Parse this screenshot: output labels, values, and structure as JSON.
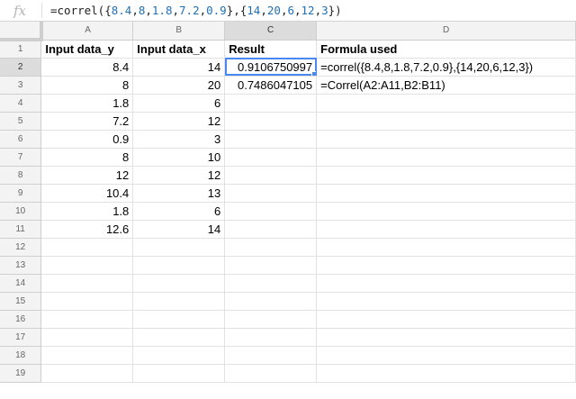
{
  "formula_bar": {
    "icon": "fx",
    "text_parts": [
      {
        "t": "=correl({",
        "n": false
      },
      {
        "t": "8.4",
        "n": true
      },
      {
        "t": ",",
        "n": false
      },
      {
        "t": "8",
        "n": true
      },
      {
        "t": ",",
        "n": false
      },
      {
        "t": "1.8",
        "n": true
      },
      {
        "t": ",",
        "n": false
      },
      {
        "t": "7.2",
        "n": true
      },
      {
        "t": ",",
        "n": false
      },
      {
        "t": "0.9",
        "n": true
      },
      {
        "t": "},{",
        "n": false
      },
      {
        "t": "14",
        "n": true
      },
      {
        "t": ",",
        "n": false
      },
      {
        "t": "20",
        "n": true
      },
      {
        "t": ",",
        "n": false
      },
      {
        "t": "6",
        "n": true
      },
      {
        "t": ",",
        "n": false
      },
      {
        "t": "12",
        "n": true
      },
      {
        "t": ",",
        "n": false
      },
      {
        "t": "3",
        "n": true
      },
      {
        "t": "})",
        "n": false
      }
    ]
  },
  "columns": [
    "A",
    "B",
    "C",
    "D"
  ],
  "selected": {
    "row": 2,
    "col": "C"
  },
  "rows": [
    {
      "n": "1",
      "cells": [
        "Input data_y",
        "Input data_x",
        "Result",
        "Formula used"
      ]
    },
    {
      "n": "2",
      "cells": [
        "8.4",
        "14",
        "0.9106750997",
        "=correl({8.4,8,1.8,7.2,0.9},{14,20,6,12,3})"
      ]
    },
    {
      "n": "3",
      "cells": [
        "8",
        "20",
        "0.7486047105",
        "=Correl(A2:A11,B2:B11)"
      ]
    },
    {
      "n": "4",
      "cells": [
        "1.8",
        "6",
        "",
        ""
      ]
    },
    {
      "n": "5",
      "cells": [
        "7.2",
        "12",
        "",
        ""
      ]
    },
    {
      "n": "6",
      "cells": [
        "0.9",
        "3",
        "",
        ""
      ]
    },
    {
      "n": "7",
      "cells": [
        "8",
        "10",
        "",
        ""
      ]
    },
    {
      "n": "8",
      "cells": [
        "12",
        "12",
        "",
        ""
      ]
    },
    {
      "n": "9",
      "cells": [
        "10.4",
        "13",
        "",
        ""
      ]
    },
    {
      "n": "10",
      "cells": [
        "1.8",
        "6",
        "",
        ""
      ]
    },
    {
      "n": "11",
      "cells": [
        "12.6",
        "14",
        "",
        ""
      ]
    },
    {
      "n": "12",
      "cells": [
        "",
        "",
        "",
        ""
      ]
    },
    {
      "n": "13",
      "cells": [
        "",
        "",
        "",
        ""
      ]
    },
    {
      "n": "14",
      "cells": [
        "",
        "",
        "",
        ""
      ]
    },
    {
      "n": "15",
      "cells": [
        "",
        "",
        "",
        ""
      ]
    },
    {
      "n": "16",
      "cells": [
        "",
        "",
        "",
        ""
      ]
    },
    {
      "n": "17",
      "cells": [
        "",
        "",
        "",
        ""
      ]
    },
    {
      "n": "18",
      "cells": [
        "",
        "",
        "",
        ""
      ]
    },
    {
      "n": "19",
      "cells": [
        "",
        "",
        "",
        ""
      ]
    }
  ]
}
